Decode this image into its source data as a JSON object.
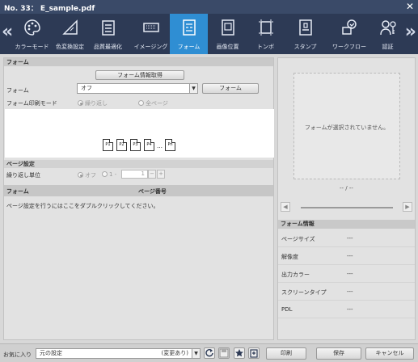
{
  "window": {
    "title": "No. 33： E_sample.pdf",
    "close_icon": "close-icon"
  },
  "toolbar": {
    "nav_left": "«",
    "nav_right": "»",
    "tabs": [
      {
        "label": "カラーモード",
        "icon": "palette-icon"
      },
      {
        "label": "色変換設定",
        "icon": "color-convert-icon"
      },
      {
        "label": "品質最適化",
        "icon": "checklist-icon"
      },
      {
        "label": "イメージング",
        "icon": "imaging-icon"
      },
      {
        "label": "フォーム",
        "icon": "form-icon",
        "active": true
      },
      {
        "label": "画像位置",
        "icon": "image-position-icon"
      },
      {
        "label": "トンボ",
        "icon": "crop-marks-icon"
      },
      {
        "label": "スタンプ",
        "icon": "stamp-icon"
      },
      {
        "label": "ワークフロー",
        "icon": "workflow-icon"
      },
      {
        "label": "認証",
        "icon": "auth-icon"
      }
    ],
    "active_color": "#2f8ed3"
  },
  "form": {
    "section_title": "フォーム",
    "get_info_button": "フォーム情報取得",
    "form_label": "フォーム",
    "form_select_value": "オフ",
    "form_button": "フォーム",
    "print_mode_label": "フォーム印刷モード",
    "mode_repeat": "繰り返し",
    "mode_all_pages": "全ページ",
    "preview_pages": [
      "P1",
      "P2",
      "P3",
      "P4",
      "Pn"
    ],
    "preview_dots": "…"
  },
  "page_settings": {
    "title": "ページ設定",
    "repeat_unit_label": "繰り返し単位",
    "off_option": "オフ",
    "one_option": "1 -",
    "spin_value": "1",
    "minus": "−",
    "plus": "+",
    "col_form": "フォーム",
    "col_page_number": "ページ番号",
    "hint": "ページ設定を行うにはここをダブルクリックしてください。"
  },
  "preview_panel": {
    "message": "フォームが選択されていません。",
    "page_indicator": "-- / --",
    "prev": "◀",
    "next": "▶"
  },
  "form_info": {
    "title": "フォーム情報",
    "rows": [
      {
        "key": "ページサイズ",
        "value": "---"
      },
      {
        "key": "解像度",
        "value": "---"
      },
      {
        "key": "出力カラー",
        "value": "---"
      },
      {
        "key": "スクリーンタイプ",
        "value": "---"
      },
      {
        "key": "PDL",
        "value": "---"
      }
    ]
  },
  "bottom": {
    "favorites_label": "お気に入り",
    "favorites_value": "元の設定",
    "modified_text": "(変更あり)",
    "print_button": "印刷",
    "save_button": "保存",
    "cancel_button": "キャンセル"
  }
}
